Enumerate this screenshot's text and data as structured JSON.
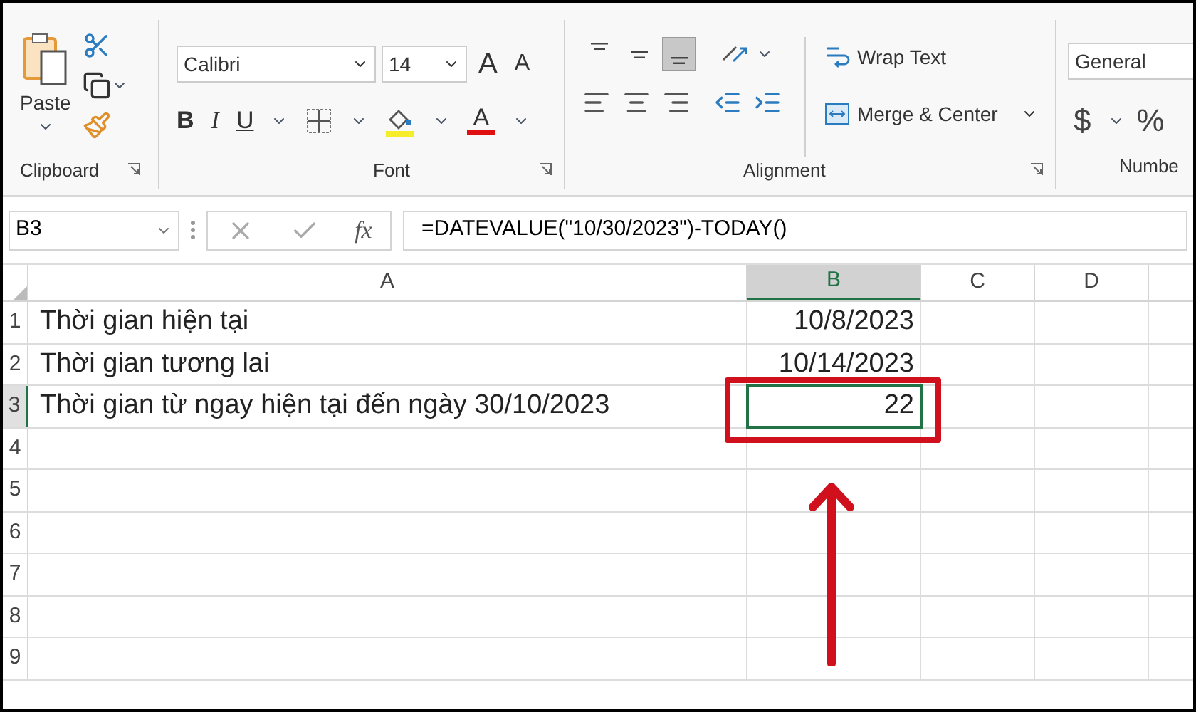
{
  "ribbon": {
    "clipboard": {
      "label": "Clipboard",
      "paste_label": "Paste"
    },
    "font": {
      "label": "Font",
      "font_name": "Calibri",
      "font_size": "14",
      "grow_glyph": "A",
      "shrink_glyph": "A",
      "style_buttons": [
        "B",
        "I",
        "U"
      ],
      "font_color_glyph": "A"
    },
    "alignment": {
      "label": "Alignment",
      "wrap_text": "Wrap Text",
      "merge_center": "Merge & Center",
      "vertical_align": [
        {
          "kind": "top",
          "selected": false
        },
        {
          "kind": "middle",
          "selected": false
        },
        {
          "kind": "bottom",
          "selected": true
        }
      ]
    },
    "number": {
      "label": "Numbe",
      "format": "General",
      "currency": "$",
      "percent": "%"
    }
  },
  "formula_bar": {
    "name_box": "B3",
    "fx": "fx",
    "formula": "=DATEVALUE(\"10/30/2023\")-TODAY()"
  },
  "sheet": {
    "columns": [
      {
        "label": "A",
        "selected": false
      },
      {
        "label": "B",
        "selected": true
      },
      {
        "label": "C",
        "selected": false
      },
      {
        "label": "D",
        "selected": false
      }
    ],
    "rows": [
      {
        "number": "1",
        "selected": false,
        "cells": [
          "Thời gian hiện tại",
          "10/8/2023"
        ]
      },
      {
        "number": "2",
        "selected": false,
        "cells": [
          "Thời gian tương lai",
          "10/14/2023"
        ]
      },
      {
        "number": "3",
        "selected": true,
        "cells": [
          "Thời gian từ ngay hiện tại đến ngày 30/10/2023",
          "22"
        ]
      },
      {
        "number": "4",
        "selected": false,
        "cells": []
      },
      {
        "number": "5",
        "selected": false,
        "cells": []
      },
      {
        "number": "6",
        "selected": false,
        "cells": []
      },
      {
        "number": "7",
        "selected": false,
        "cells": []
      },
      {
        "number": "8",
        "selected": false,
        "cells": []
      },
      {
        "number": "9",
        "selected": false,
        "cells": []
      }
    ]
  }
}
